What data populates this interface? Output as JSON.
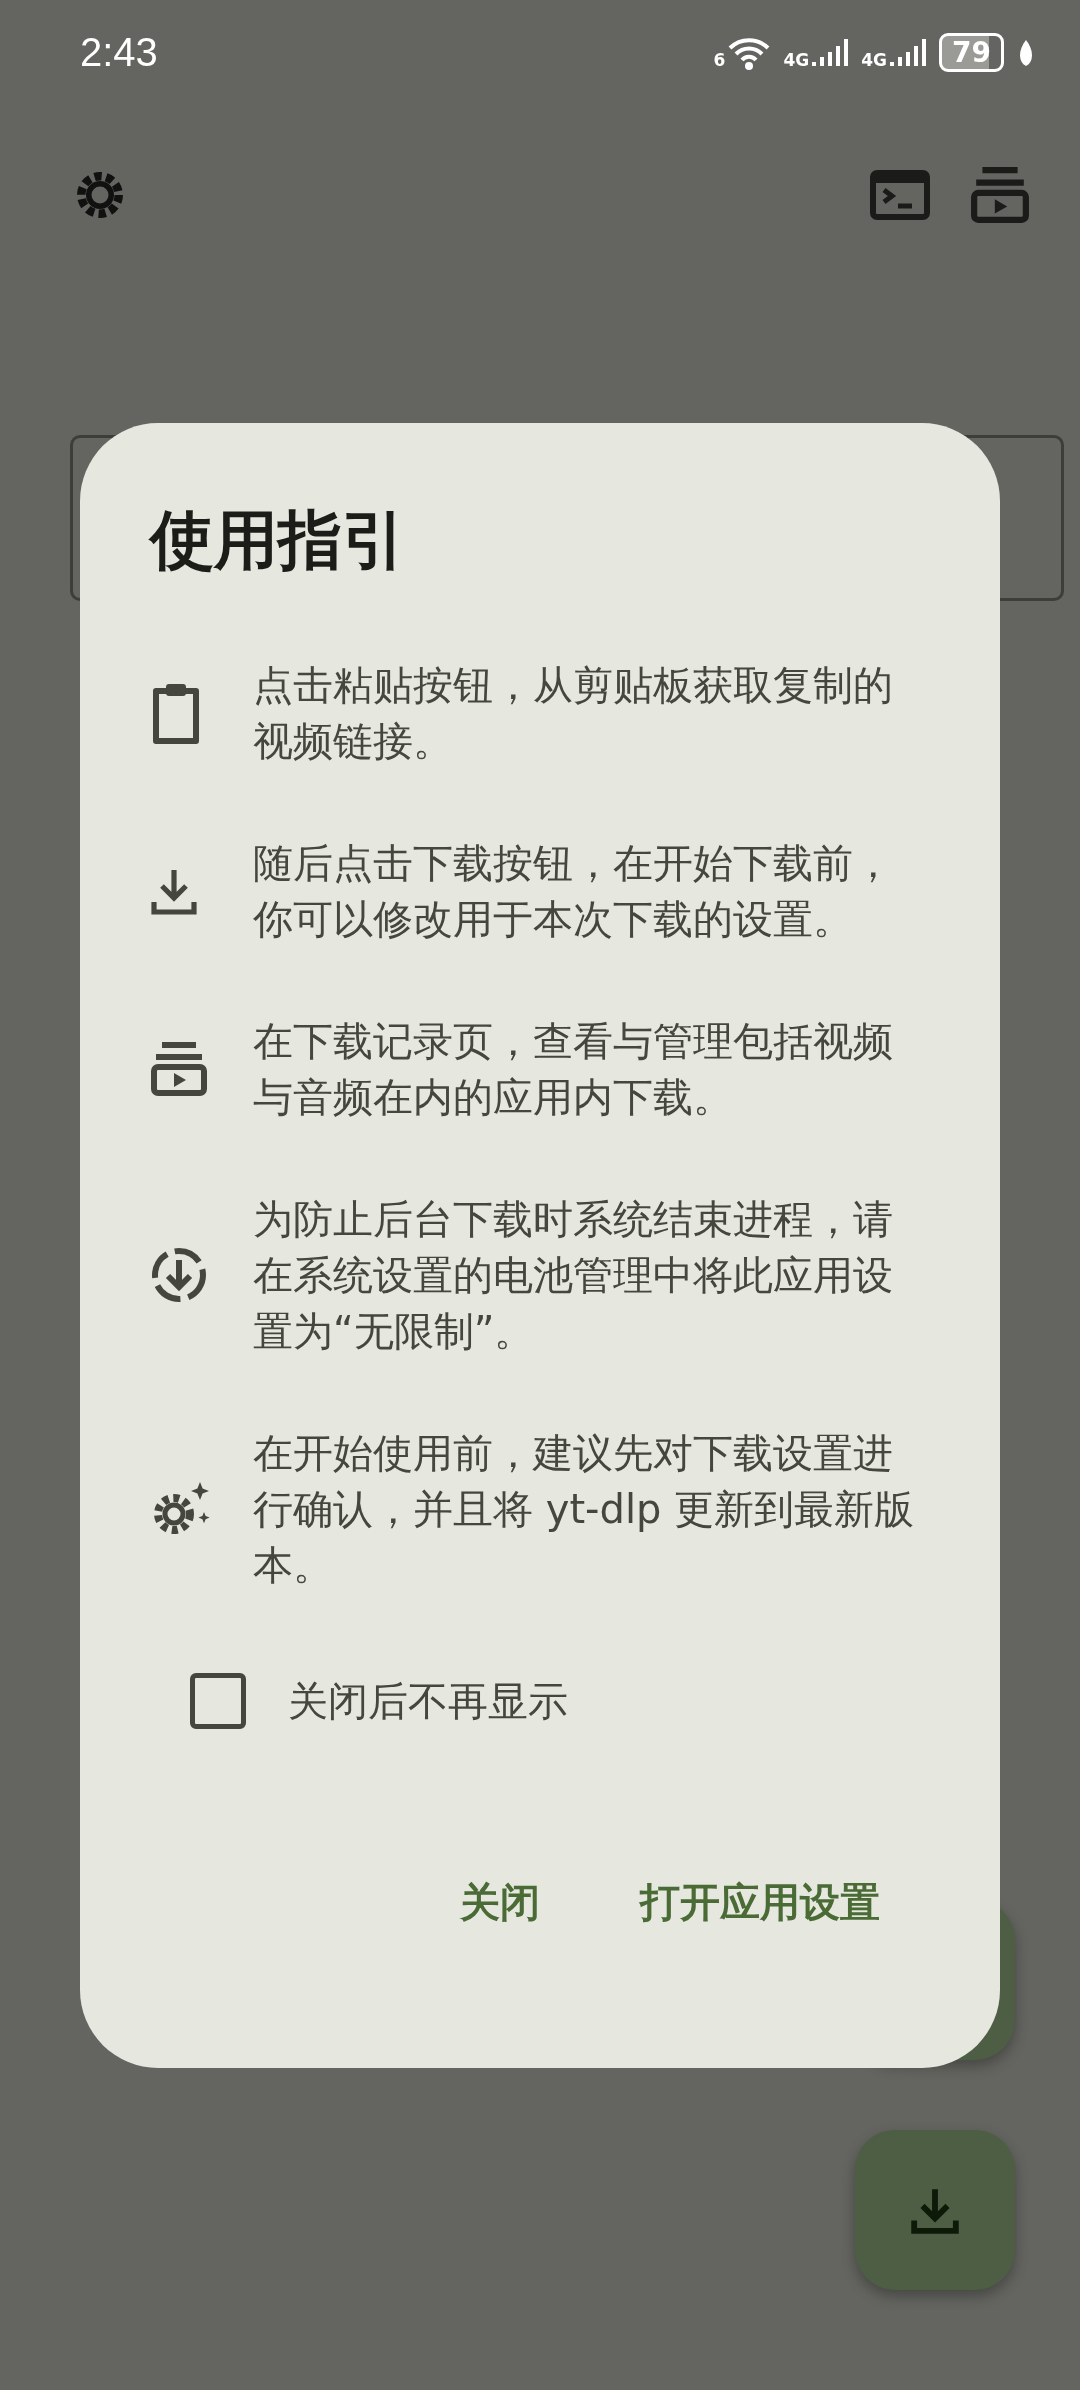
{
  "status_bar": {
    "time": "2:43",
    "wifi_label": "6",
    "signal_labels": [
      "4G",
      "4G"
    ],
    "battery": "79"
  },
  "dialog": {
    "title": "使用指引",
    "items": [
      {
        "kind": "clipboard",
        "text": "点击粘贴按钮，从剪贴板获取复制的视频链接。"
      },
      {
        "kind": "download",
        "text": "随后点击下载按钮，在开始下载前，你可以修改用于本次下载的设置。"
      },
      {
        "kind": "queue",
        "text": "在下载记录页，查看与管理包括视频与音频在内的应用内下载。"
      },
      {
        "kind": "battery",
        "text": "为防止后台下载时系统结束进程，请在系统设置的电池管理中将此应用设置为“无限制”。"
      },
      {
        "kind": "settings",
        "text": "在开始使用前，建议先对下载设置进行确认，并且将 yt-dlp 更新到最新版本。"
      }
    ],
    "checkbox": {
      "label": "关闭后不再显示",
      "checked": false
    },
    "buttons": [
      "关闭",
      "打开应用设置"
    ]
  }
}
